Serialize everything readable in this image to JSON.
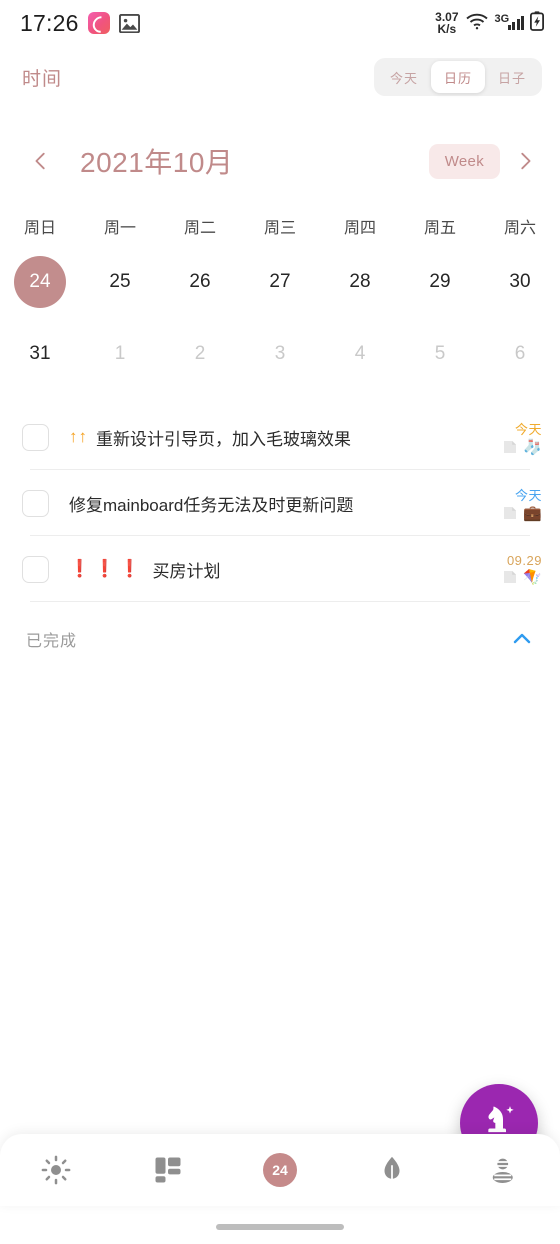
{
  "statusbar": {
    "time": "17:26",
    "network_speed_value": "3.07",
    "network_speed_unit": "K/s",
    "network_type": "3G"
  },
  "header": {
    "title": "时间",
    "tabs": [
      {
        "label": "今天",
        "active": false
      },
      {
        "label": "日历",
        "active": true
      },
      {
        "label": "日子",
        "active": false
      }
    ]
  },
  "month_nav": {
    "month_label": "2021年10月",
    "view_pill": "Week",
    "prev_label": "上一月",
    "next_label": "下一月"
  },
  "calendar": {
    "weekdays": [
      "周日",
      "周一",
      "周二",
      "周三",
      "周四",
      "周五",
      "周六"
    ],
    "rows": [
      [
        {
          "day": "24",
          "state": "selected"
        },
        {
          "day": "25",
          "state": "normal"
        },
        {
          "day": "26",
          "state": "normal"
        },
        {
          "day": "27",
          "state": "normal"
        },
        {
          "day": "28",
          "state": "normal"
        },
        {
          "day": "29",
          "state": "normal"
        },
        {
          "day": "30",
          "state": "normal"
        }
      ],
      [
        {
          "day": "31",
          "state": "normal"
        },
        {
          "day": "1",
          "state": "muted"
        },
        {
          "day": "2",
          "state": "muted"
        },
        {
          "day": "3",
          "state": "muted"
        },
        {
          "day": "4",
          "state": "muted"
        },
        {
          "day": "5",
          "state": "muted"
        },
        {
          "day": "6",
          "state": "muted"
        }
      ]
    ],
    "selected_color": "#c28d8d"
  },
  "tasks": [
    {
      "checked": false,
      "priority": "↑↑",
      "priority_kind": "up",
      "title": "重新设计引导页，加入毛玻璃效果",
      "date": "今天",
      "date_color_kind": "orange",
      "tag_emoji": "🧦"
    },
    {
      "checked": false,
      "priority": "",
      "priority_kind": "none",
      "title": "修复mainboard任务无法及时更新问题",
      "date": "今天",
      "date_color_kind": "blue",
      "tag_emoji": "💼"
    },
    {
      "checked": false,
      "priority": "❗❗❗",
      "priority_kind": "bang",
      "title": "买房计划",
      "date": "09.29",
      "date_color_kind": "tan",
      "tag_emoji": "🪁"
    }
  ],
  "completed_section": {
    "label": "已完成",
    "collapsed": false
  },
  "bottom_nav": {
    "items": [
      {
        "icon": "sun-icon",
        "label": "今日",
        "active": false
      },
      {
        "icon": "dashboard-icon",
        "label": "面板",
        "active": false
      },
      {
        "icon": "date-badge-icon",
        "label": "24",
        "active": true
      },
      {
        "icon": "leaf-icon",
        "label": "习惯",
        "active": false
      },
      {
        "icon": "stats-icon",
        "label": "统计",
        "active": false
      }
    ],
    "fab": {
      "icon": "knight-sparkle-icon",
      "color": "#9b27b0"
    }
  }
}
